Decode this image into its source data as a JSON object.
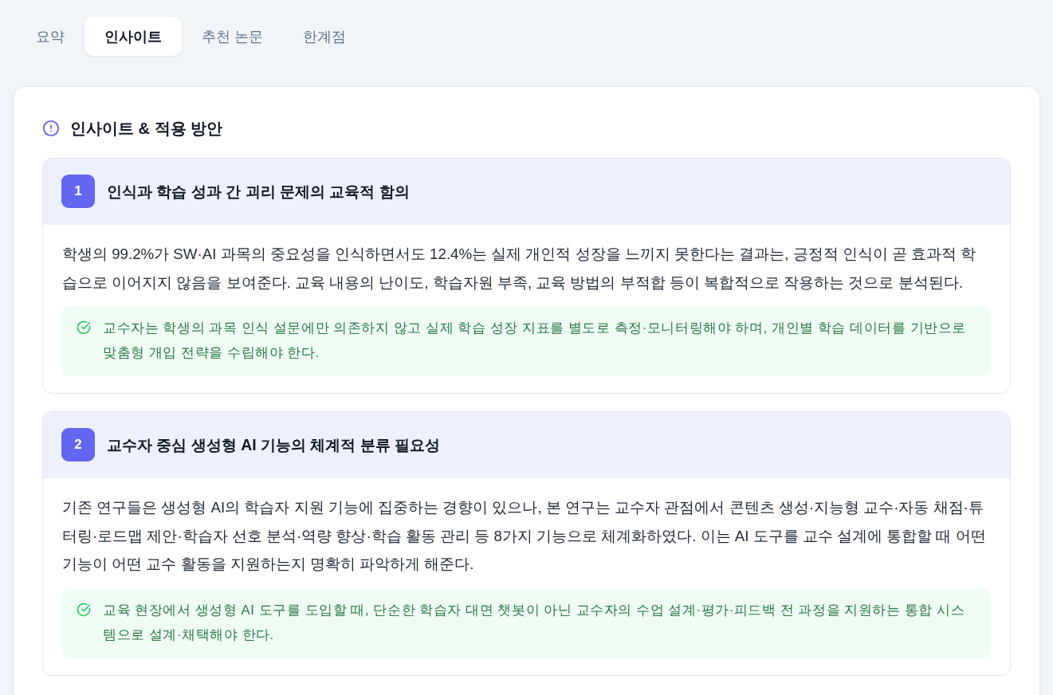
{
  "tabs": [
    {
      "label": "요약",
      "selected": false
    },
    {
      "label": "인사이트",
      "selected": true
    },
    {
      "label": "추천 논문",
      "selected": false
    },
    {
      "label": "한계점",
      "selected": false
    }
  ],
  "section": {
    "title": "인사이트 & 적용 방안"
  },
  "insights": [
    {
      "number": "1",
      "title": "인식과 학습 성과 간 괴리 문제의 교육적 함의",
      "description": "학생의 99.2%가 SW·AI 과목의 중요성을 인식하면서도 12.4%는 실제 개인적 성장을 느끼지 못한다는 결과는, 긍정적 인식이 곧 효과적 학습으로 이어지지 않음을 보여준다. 교육 내용의 난이도, 학습자원 부족, 교육 방법의 부적합 등이 복합적으로 작용하는 것으로 분석된다.",
      "recommendation": "교수자는 학생의 과목 인식 설문에만 의존하지 않고 실제 학습 성장 지표를 별도로 측정·모니터링해야 하며, 개인별 학습 데이터를 기반으로 맞춤형 개입 전략을 수립해야 한다."
    },
    {
      "number": "2",
      "title": "교수자 중심 생성형 AI 기능의 체계적 분류 필요성",
      "description": "기존 연구들은 생성형 AI의 학습자 지원 기능에 집중하는 경향이 있으나, 본 연구는 교수자 관점에서 콘텐츠 생성·지능형 교수·자동 채점·튜터링·로드맵 제안·학습자 선호 분석·역량 향상·학습 활동 관리 등 8가지 기능으로 체계화하였다. 이는 AI 도구를 교수 설계에 통합할 때 어떤 기능이 어떤 교수 활동을 지원하는지 명확히 파악하게 해준다.",
      "recommendation": "교육 현장에서 생성형 AI 도구를 도입할 때, 단순한 학습자 대면 챗봇이 아닌 교수자의 수업 설계·평가·피드백 전 과정을 지원하는 통합 시스템으로 설계·채택해야 한다."
    }
  ]
}
